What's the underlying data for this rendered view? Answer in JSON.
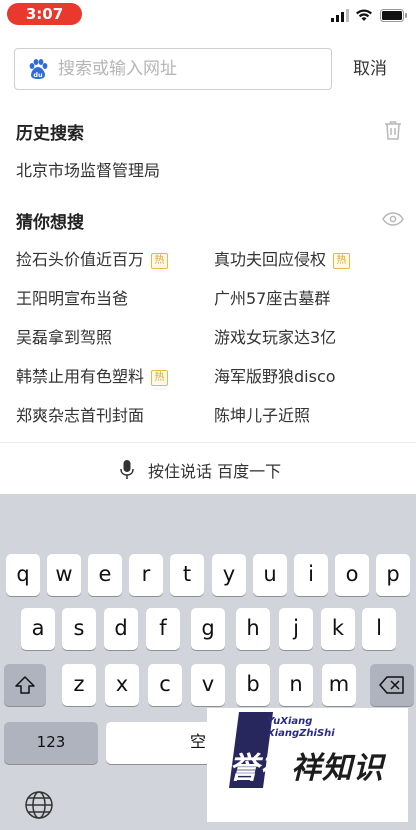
{
  "status_bar": {
    "time": "3:07",
    "accent_color": "#e8392c",
    "icons": [
      "cellular-signal-icon",
      "wifi-icon",
      "battery-icon"
    ]
  },
  "search": {
    "placeholder": "搜索或输入网址",
    "value": "",
    "cancel_label": "取消",
    "icon": "baidu-paw-icon"
  },
  "history": {
    "title": "历史搜索",
    "icon": "trash-icon",
    "items": [
      "北京市场监督管理局"
    ]
  },
  "guess": {
    "title": "猜你想搜",
    "icon": "eye-icon",
    "hot_badge_label": "热",
    "items": [
      {
        "text": "捡石头价值近百万",
        "hot": true
      },
      {
        "text": "真功夫回应侵权",
        "hot": true
      },
      {
        "text": "王阳明宣布当爸",
        "hot": false
      },
      {
        "text": "广州57座古墓群",
        "hot": false
      },
      {
        "text": "吴磊拿到驾照",
        "hot": false
      },
      {
        "text": "游戏女玩家达3亿",
        "hot": false
      },
      {
        "text": "韩禁止用有色塑料",
        "hot": true
      },
      {
        "text": "海军版野狼disco",
        "hot": false
      },
      {
        "text": "郑爽杂志首刊封面",
        "hot": false
      },
      {
        "text": "陈坤儿子近照",
        "hot": false
      }
    ]
  },
  "voice": {
    "label": "按住说话 百度一下",
    "icon": "microphone-icon"
  },
  "keyboard": {
    "row1": [
      "q",
      "w",
      "e",
      "r",
      "t",
      "y",
      "u",
      "i",
      "o",
      "p"
    ],
    "row2": [
      "a",
      "s",
      "d",
      "f",
      "g",
      "h",
      "j",
      "k",
      "l"
    ],
    "row3": [
      "z",
      "x",
      "c",
      "v",
      "b",
      "n",
      "m"
    ],
    "shift_icon": "shift-icon",
    "delete_icon": "delete-icon",
    "numbers_label": "123",
    "space_label": "空",
    "globe_icon": "globe-icon"
  },
  "watermark": {
    "top_line1": "YuXiang",
    "top_line2": "XiangZhiShi",
    "main_part1": "誉祥",
    "main_part2": "祥知识"
  }
}
